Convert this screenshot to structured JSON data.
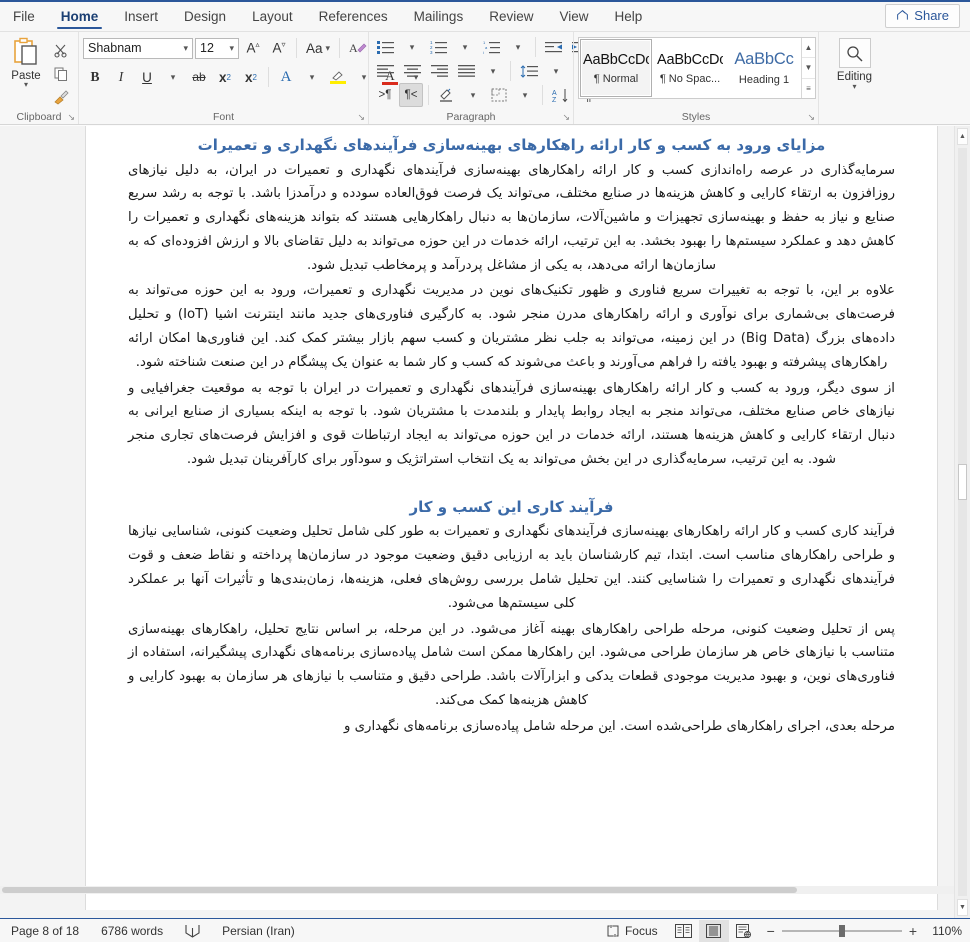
{
  "tabs": [
    {
      "label": "File",
      "active": false
    },
    {
      "label": "Home",
      "active": true
    },
    {
      "label": "Insert",
      "active": false
    },
    {
      "label": "Design",
      "active": false
    },
    {
      "label": "Layout",
      "active": false
    },
    {
      "label": "References",
      "active": false
    },
    {
      "label": "Mailings",
      "active": false
    },
    {
      "label": "Review",
      "active": false
    },
    {
      "label": "View",
      "active": false
    },
    {
      "label": "Help",
      "active": false
    }
  ],
  "share": {
    "label": "Share",
    "icon": "share-icon"
  },
  "ribbon": {
    "clipboard": {
      "label": "Clipboard",
      "paste_label": "Paste",
      "paste_icon": "paste-icon",
      "cut_icon": "scissors-icon",
      "copy_icon": "copy-icon",
      "format_painter_icon": "format-painter-icon",
      "dialog_launcher": "↘"
    },
    "font": {
      "label": "Font",
      "font_name": "Shabnam",
      "font_size": "12",
      "grow_font_icon": "grow-font-icon",
      "shrink_font_icon": "shrink-font-icon",
      "change_case_label": "Aa",
      "clear_formatting_icon": "clear-formatting-icon",
      "bold_label": "B",
      "italic_label": "I",
      "underline_label": "U",
      "strikethrough_label": "ab",
      "subscript_label": "x",
      "superscript_label": "x",
      "text_effects_label": "A",
      "highlight_label": "A",
      "font_color_label": "A",
      "dialog_launcher": "↘"
    },
    "paragraph": {
      "label": "Paragraph",
      "bullets_icon": "bullet-list-icon",
      "numbering_icon": "numbered-list-icon",
      "multilevel_icon": "multilevel-list-icon",
      "decrease_indent_icon": "decrease-indent-icon",
      "increase_indent_icon": "increase-indent-icon",
      "align_left_icon": "align-left-icon",
      "align_center_icon": "align-center-icon",
      "align_right_icon": "align-right-icon",
      "justify_icon": "justify-icon",
      "line_spacing_icon": "line-spacing-icon",
      "ltr_label": ">¶",
      "rtl_label": "¶<",
      "shading_icon": "shading-icon",
      "borders_icon": "borders-icon",
      "sort_icon": "sort-icon",
      "show_marks_label": "¶",
      "dialog_launcher": "↘"
    },
    "styles": {
      "label": "Styles",
      "items": [
        {
          "preview": "AaBbCcDc",
          "name": "¶ Normal",
          "selected": true,
          "heading": false
        },
        {
          "preview": "AaBbCcDc",
          "name": "¶ No Spac...",
          "selected": false,
          "heading": false
        },
        {
          "preview": "AaBbCс",
          "name": "Heading 1",
          "selected": false,
          "heading": true
        }
      ],
      "scroll_up": "▲",
      "scroll_down": "▼",
      "more": "▾",
      "dialog_launcher": "↘"
    },
    "editing": {
      "label": "Editing",
      "icon": "search-icon",
      "chevron": "⌄"
    }
  },
  "document": {
    "blocks": [
      {
        "type": "heading",
        "text": "مزایای ورود به کسب و کار ارائه راهکارهای بهینه‌سازی فرآیندهای نگهداری و تعمیرات"
      },
      {
        "type": "paragraph",
        "text": "سرمایه‌گذاری در عرصه راه‌اندازی کسب و کار ارائه راهکارهای بهینه‌سازی فرآیندهای نگهداری و تعمیرات در ایران، به دلیل نیازهای روزافزون به ارتقاء کارایی و کاهش هزینه‌ها در صنایع مختلف، می‌تواند یک فرصت فوق‌العاده سودده و درآمدزا باشد. با توجه به رشد سریع صنایع و نیاز به حفظ و بهینه‌سازی تجهیزات و ماشین‌آلات، سازمان‌ها به دنبال راهکارهایی هستند که بتواند هزینه‌های نگهداری و تعمیرات را کاهش دهد و عملکرد سیستم‌ها را بهبود بخشد. به این ترتیب، ارائه خدمات در این حوزه می‌تواند به دلیل تقاضای بالا و ارزش افزوده‌ای که به سازمان‌ها ارائه می‌دهد، به یکی از مشاغل پردرآمد و پرمخاطب تبدیل شود."
      },
      {
        "type": "paragraph",
        "text": "علاوه بر این، با توجه به تغییرات سریع فناوری و ظهور تکنیک‌های نوین در مدیریت نگهداری و تعمیرات، ورود به این حوزه می‌تواند به فرصت‌های بی‌شماری برای نوآوری و ارائه راهکارهای مدرن منجر شود. به کارگیری فناوری‌های جدید مانند اینترنت اشیا (IoT) و تحلیل داده‌های بزرگ (Big Data) در این زمینه، می‌تواند به جلب نظر مشتریان و کسب سهم بازار بیشتر کمک کند. این فناوری‌ها امکان ارائه راهکارهای پیشرفته و بهبود یافته را فراهم می‌آورند و باعث می‌شوند که کسب و کار شما به عنوان یک پیشگام در این صنعت شناخته شود."
      },
      {
        "type": "paragraph",
        "text": "از سوی دیگر، ورود به کسب و کار ارائه راهکارهای بهینه‌سازی فرآیندهای نگهداری و تعمیرات در ایران با توجه به موقعیت جغرافیایی و نیازهای خاص صنایع مختلف، می‌تواند منجر به ایجاد روابط پایدار و بلندمدت با مشتریان شود. با توجه به اینکه بسیاری از صنایع ایرانی به دنبال ارتقاء کارایی و کاهش هزینه‌ها هستند، ارائه خدمات در این حوزه می‌تواند به ایجاد ارتباطات قوی و افزایش فرصت‌های تجاری منجر شود. به این ترتیب، سرمایه‌گذاری در این بخش می‌تواند به یک انتخاب استراتژیک و سودآور برای کارآفرینان تبدیل شود."
      },
      {
        "type": "heading-sub",
        "text": "فرآیند کاری این کسب و کار"
      },
      {
        "type": "paragraph",
        "text": "فرآیند کاری کسب و کار ارائه راهکارهای بهینه‌سازی فرآیندهای نگهداری و تعمیرات به طور کلی شامل تحلیل وضعیت کنونی، شناسایی نیازها و طراحی راهکارهای مناسب است. ابتدا، تیم کارشناسان باید به ارزیابی دقیق وضعیت موجود در سازمان‌ها پرداخته و نقاط ضعف و قوت فرآیندهای نگهداری و تعمیرات را شناسایی کنند. این تحلیل شامل بررسی روش‌های فعلی، هزینه‌ها، زمان‌بندی‌ها و تأثیرات آنها بر عملکرد کلی سیستم‌ها می‌شود."
      },
      {
        "type": "paragraph",
        "text": "پس از تحلیل وضعیت کنونی، مرحله طراحی راهکارهای بهینه آغاز می‌شود. در این مرحله، بر اساس نتایج تحلیل، راهکارهای بهینه‌سازی متناسب با نیازهای خاص هر سازمان طراحی می‌شود. این راهکارها ممکن است شامل پیاده‌سازی برنامه‌های نگهداری پیشگیرانه، استفاده از فناوری‌های نوین، و بهبود مدیریت موجودی قطعات یدکی و ابزارآلات باشد. طراحی دقیق و متناسب با نیازهای هر سازمان به بهبود کارایی و کاهش هزینه‌ها کمک می‌کند."
      },
      {
        "type": "paragraph",
        "text": "مرحله بعدی، اجرای راهکارهای طراحی‌شده است. این مرحله شامل پیاده‌سازی برنامه‌های نگهداری و"
      }
    ]
  },
  "status": {
    "page_label": "Page 8 of 18",
    "word_count": "6786 words",
    "proofing_icon": "proofing-icon",
    "language": "Persian (Iran)",
    "focus_label": "Focus",
    "focus_icon": "focus-icon",
    "view_read_icon": "read-mode-icon",
    "view_print_icon": "print-layout-icon",
    "view_web_icon": "web-layout-icon",
    "zoom_out": "−",
    "zoom_in": "+",
    "zoom_level": "110%"
  },
  "colors": {
    "accent": "#2b579a",
    "heading": "#3b6aa8",
    "ribbon_bg": "#f7f7f7",
    "page_bg": "#f3f3f3"
  }
}
